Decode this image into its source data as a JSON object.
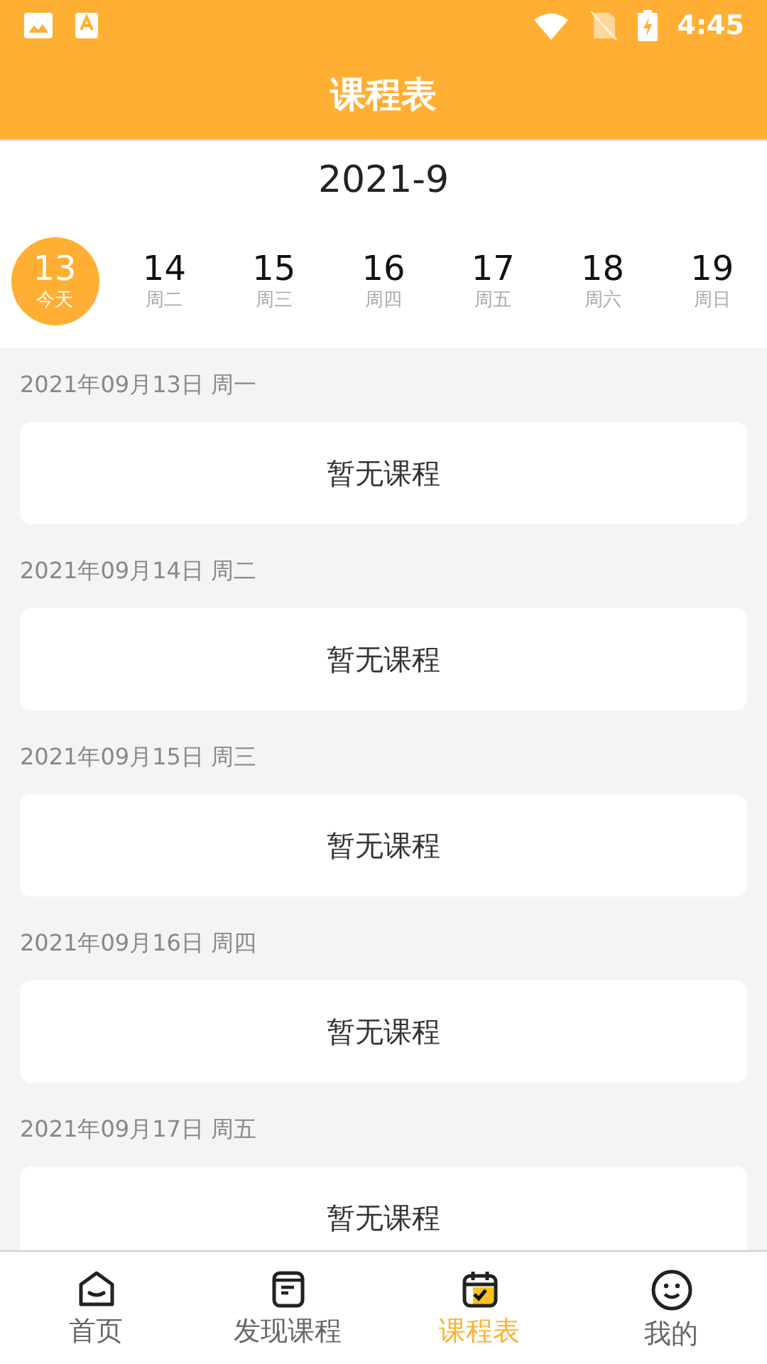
{
  "status_bar": {
    "time": "4:45"
  },
  "title": "课程表",
  "month": "2021-9",
  "days": [
    {
      "day": "13",
      "weekday": "今天",
      "selected": true
    },
    {
      "day": "14",
      "weekday": "周二",
      "selected": false
    },
    {
      "day": "15",
      "weekday": "周三",
      "selected": false
    },
    {
      "day": "16",
      "weekday": "周四",
      "selected": false
    },
    {
      "day": "17",
      "weekday": "周五",
      "selected": false
    },
    {
      "day": "18",
      "weekday": "周六",
      "selected": false
    },
    {
      "day": "19",
      "weekday": "周日",
      "selected": false
    }
  ],
  "sections": [
    {
      "date": "2021年09月13日 周一",
      "message": "暂无课程"
    },
    {
      "date": "2021年09月14日 周二",
      "message": "暂无课程"
    },
    {
      "date": "2021年09月15日 周三",
      "message": "暂无课程"
    },
    {
      "date": "2021年09月16日 周四",
      "message": "暂无课程"
    },
    {
      "date": "2021年09月17日 周五",
      "message": "暂无课程"
    }
  ],
  "tabs": [
    {
      "kind": "home",
      "label": "首页",
      "selected": false
    },
    {
      "kind": "discover",
      "label": "发现课程",
      "selected": false
    },
    {
      "kind": "schedule",
      "label": "课程表",
      "selected": true
    },
    {
      "kind": "me",
      "label": "我的",
      "selected": false
    }
  ]
}
